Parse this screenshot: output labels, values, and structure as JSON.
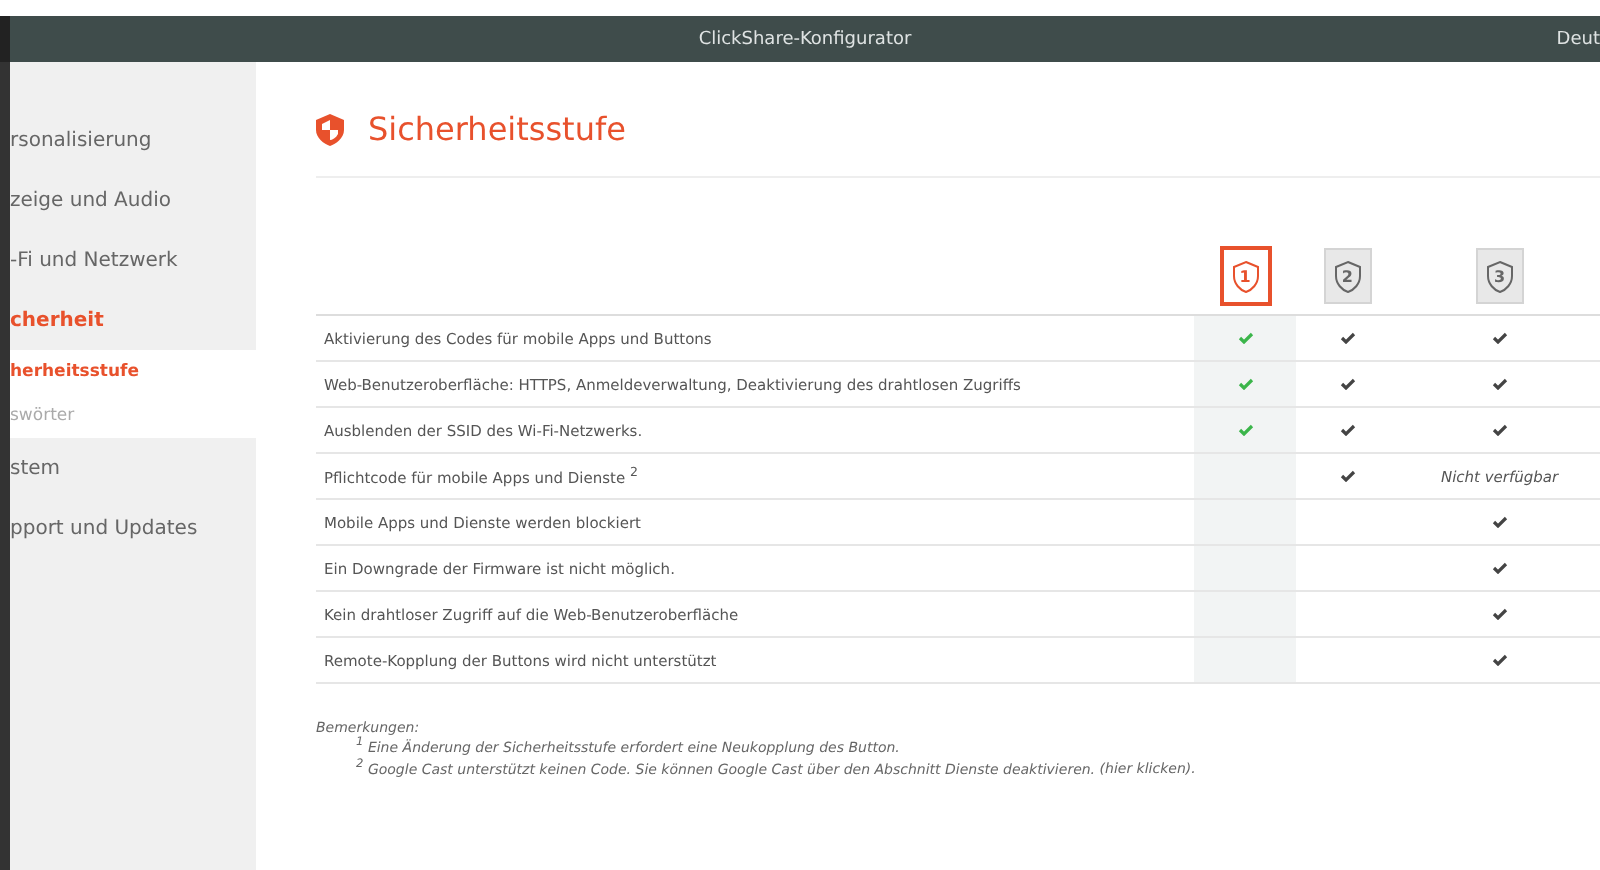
{
  "window": {
    "title": "ClickShare-Konfigurator",
    "language": "Deut"
  },
  "sidebar": {
    "items": [
      {
        "label": "rsonalisierung",
        "kind": "section",
        "selected": false
      },
      {
        "label": "zeige und Audio",
        "kind": "section",
        "selected": false
      },
      {
        "label": "-Fi und Netzwerk",
        "kind": "section",
        "selected": false
      },
      {
        "label": "cherheit",
        "kind": "section",
        "selected": true
      },
      {
        "label": "herheitsstufe",
        "kind": "sub",
        "selected": true
      },
      {
        "label": "swörter",
        "kind": "sub",
        "selected": false
      },
      {
        "label": "stem",
        "kind": "section",
        "selected": false
      },
      {
        "label": "pport und Updates",
        "kind": "section",
        "selected": false
      }
    ]
  },
  "page": {
    "title": "Sicherheitsstufe"
  },
  "levels": [
    {
      "label": "1",
      "selected": true
    },
    {
      "label": "2",
      "selected": false
    },
    {
      "label": "3",
      "selected": false
    }
  ],
  "table": {
    "rows": [
      {
        "label": "Aktivierung des Codes für mobile Apps und Buttons",
        "cells": [
          {
            "kind": "check"
          },
          {
            "kind": "check"
          },
          {
            "kind": "check"
          }
        ]
      },
      {
        "label": "Web-Benutzeroberfläche: HTTPS, Anmeldeverwaltung, Deaktivierung des drahtlosen Zugriffs",
        "cells": [
          {
            "kind": "check"
          },
          {
            "kind": "check"
          },
          {
            "kind": "check"
          }
        ]
      },
      {
        "label": "Ausblenden der SSID des Wi-Fi-Netzwerks.",
        "cells": [
          {
            "kind": "check"
          },
          {
            "kind": "check"
          },
          {
            "kind": "check"
          }
        ]
      },
      {
        "label": "Pflichtcode für mobile Apps und Dienste $^{2}$",
        "cells": [
          {
            "kind": "empty"
          },
          {
            "kind": "check"
          },
          {
            "kind": "text",
            "text": "Nicht verfügbar"
          }
        ]
      },
      {
        "label": "Mobile Apps und Dienste werden blockiert",
        "cells": [
          {
            "kind": "empty"
          },
          {
            "kind": "empty"
          },
          {
            "kind": "check"
          }
        ]
      },
      {
        "label": "Ein Downgrade der Firmware ist nicht möglich.",
        "cells": [
          {
            "kind": "empty"
          },
          {
            "kind": "empty"
          },
          {
            "kind": "check"
          }
        ]
      },
      {
        "label": "Kein drahtloser Zugriff auf die Web-Benutzeroberfläche",
        "cells": [
          {
            "kind": "empty"
          },
          {
            "kind": "empty"
          },
          {
            "kind": "check"
          }
        ]
      },
      {
        "label": "Remote-Kopplung der Buttons wird nicht unterstützt",
        "cells": [
          {
            "kind": "empty"
          },
          {
            "kind": "empty"
          },
          {
            "kind": "check"
          }
        ]
      }
    ]
  },
  "notes": {
    "heading": "Bemerkungen:",
    "items": [
      {
        "text": "$^{1}$ Eine Änderung der Sicherheitsstufe erfordert eine Neukopplung des Button."
      },
      {
        "text": "$^{2}$ Google Cast unterstützt keinen Code. Sie können Google Cast über den Abschnitt Dienste deaktivieren.",
        "link": "(hier klicken)."
      }
    ]
  }
}
